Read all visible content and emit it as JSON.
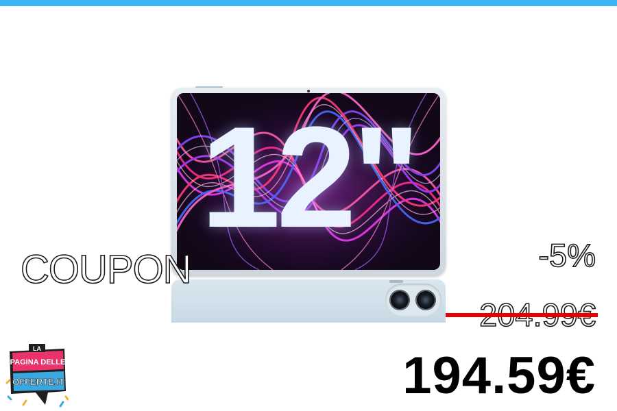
{
  "accent_color": "#3cb4f5",
  "product": {
    "screen_size_text": "12\"",
    "image": "tablet-and-phone"
  },
  "coupon": {
    "label": "COUPON"
  },
  "pricing": {
    "discount": "-5%",
    "old_price": "204.99€",
    "new_price": "194.59€",
    "strike_color": "#e60000"
  },
  "logo": {
    "line1": "LA",
    "line2": "PAGINA DELLE",
    "line3": "OFFERTE.IT"
  }
}
